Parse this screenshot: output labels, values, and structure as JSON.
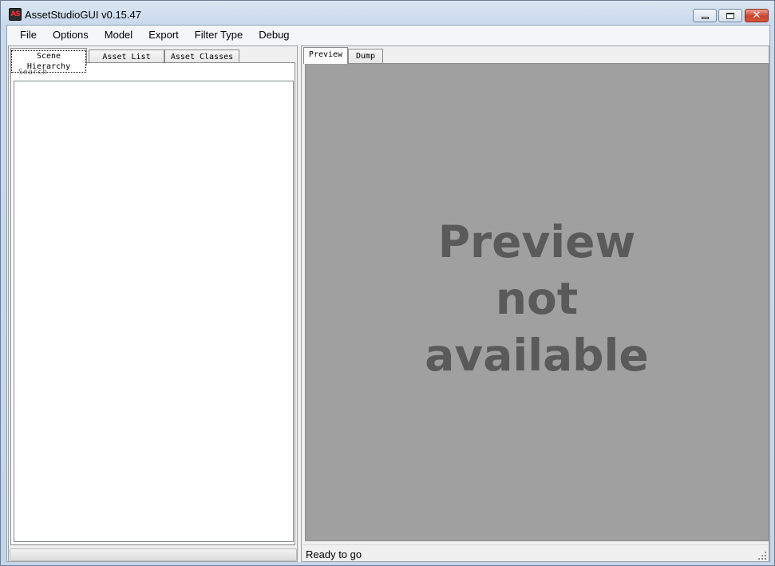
{
  "window": {
    "title": "AssetStudioGUI v0.15.47",
    "icon_text": "AS",
    "buttons": {
      "minimize": "minimize",
      "maximize": "restore",
      "close": "close"
    }
  },
  "menu": {
    "items": [
      "File",
      "Options",
      "Model",
      "Export",
      "Filter Type",
      "Debug"
    ]
  },
  "left_panel": {
    "tabs": [
      "Scene Hierarchy",
      "Asset List",
      "Asset Classes"
    ],
    "active_tab": "Scene Hierarchy",
    "search_placeholder": "Search",
    "progress": 0
  },
  "right_panel": {
    "tabs": [
      "Preview",
      "Dump"
    ],
    "active_tab": "Preview",
    "preview_message": "Preview not available",
    "status": "Ready to go"
  },
  "colors": {
    "preview_bg": "#a0a0a0",
    "preview_text": "#5a5a5a",
    "close_button": "#c8432b",
    "progress_fill": "#06b025"
  }
}
